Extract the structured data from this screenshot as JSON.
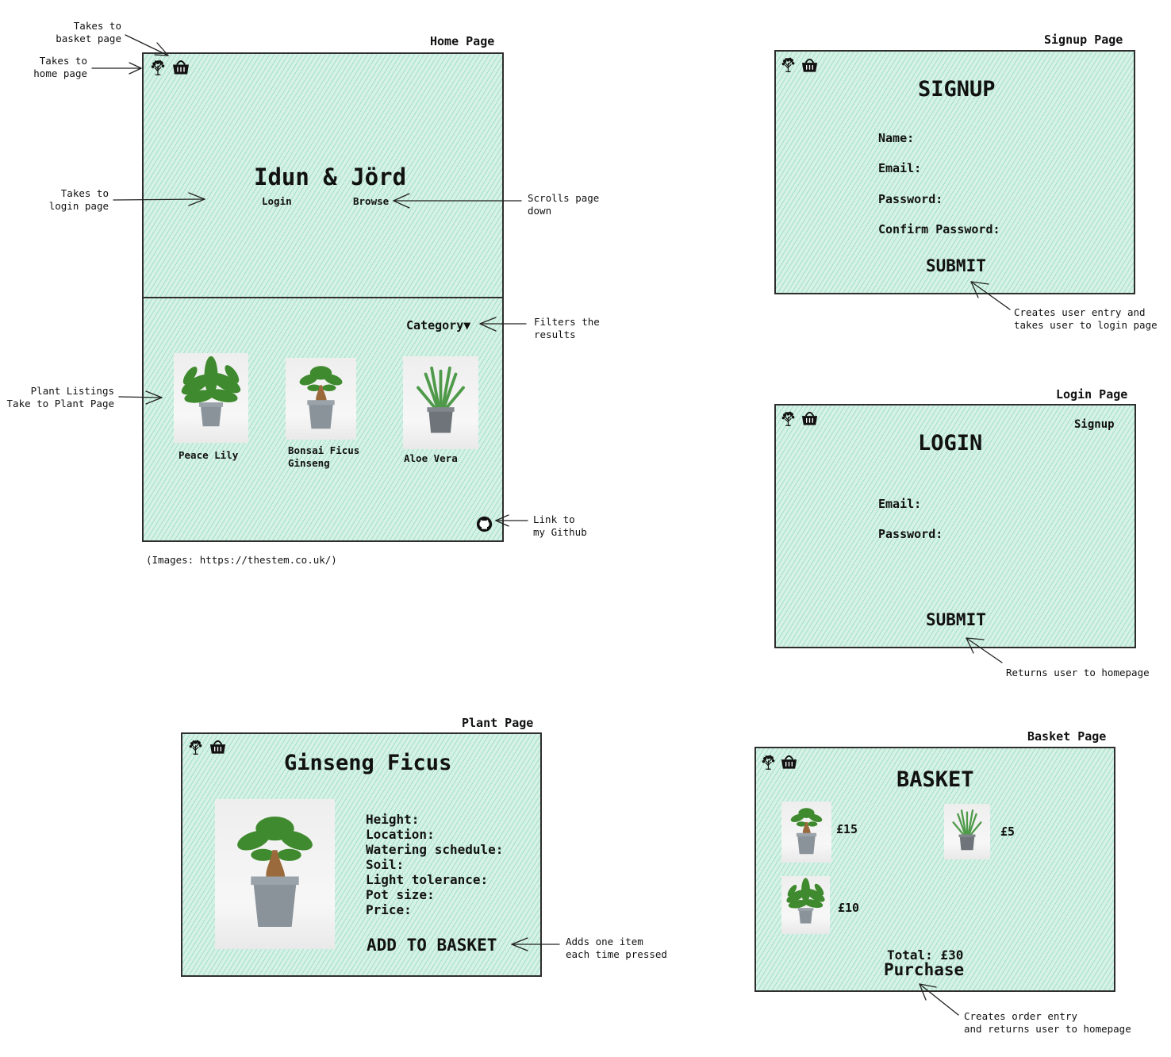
{
  "home": {
    "page_label": "Home Page",
    "title": "Idun & Jörd",
    "login": "Login",
    "browse": "Browse",
    "category": "Category▼",
    "listings": [
      {
        "name": "Peace Lily"
      },
      {
        "name": "Bonsai Ficus\nGinseng"
      },
      {
        "name": "Aloe Vera"
      }
    ],
    "image_credit": "(Images: https://thestem.co.uk/)"
  },
  "annotations": {
    "basket": "Takes to\nbasket page",
    "home": "Takes to\nhome page",
    "login": "Takes to\nlogin page",
    "scroll": "Scrolls page\ndown",
    "filter": "Filters the\nresults",
    "listings": "Plant Listings\nTake to Plant Page",
    "github": "Link to\nmy Github",
    "signup_submit": "Creates user entry and\ntakes user to login page",
    "login_submit": "Returns user to homepage",
    "add_basket": "Adds one item\neach time pressed",
    "purchase": "Creates order entry\nand returns user to homepage"
  },
  "signup": {
    "page_label": "Signup Page",
    "title": "SIGNUP",
    "fields": [
      "Name:",
      "Email:",
      "Password:",
      "Confirm Password:"
    ],
    "submit": "SUBMIT"
  },
  "login": {
    "page_label": "Login Page",
    "title": "LOGIN",
    "signup_link": "Signup",
    "fields": [
      "Email:",
      "Password:"
    ],
    "submit": "SUBMIT"
  },
  "plant": {
    "page_label": "Plant Page",
    "title": "Ginseng Ficus",
    "fields": [
      "Height:",
      "Location:",
      "Watering schedule:",
      "Soil:",
      "Light tolerance:",
      "Pot size:",
      "Price:"
    ],
    "add_button": "ADD TO BASKET"
  },
  "basket": {
    "page_label": "Basket Page",
    "title": "BASKET",
    "items": [
      {
        "price": "£15"
      },
      {
        "price": "£5"
      },
      {
        "price": "£10"
      }
    ],
    "total": "Total: £30",
    "purchase": "Purchase"
  },
  "colors": {
    "frame_fill": "#d6f1e6",
    "hatch": "#78d2b4",
    "stroke": "#2e2e2e"
  },
  "icons": [
    "tree-logo-icon",
    "basket-icon",
    "github-icon"
  ]
}
